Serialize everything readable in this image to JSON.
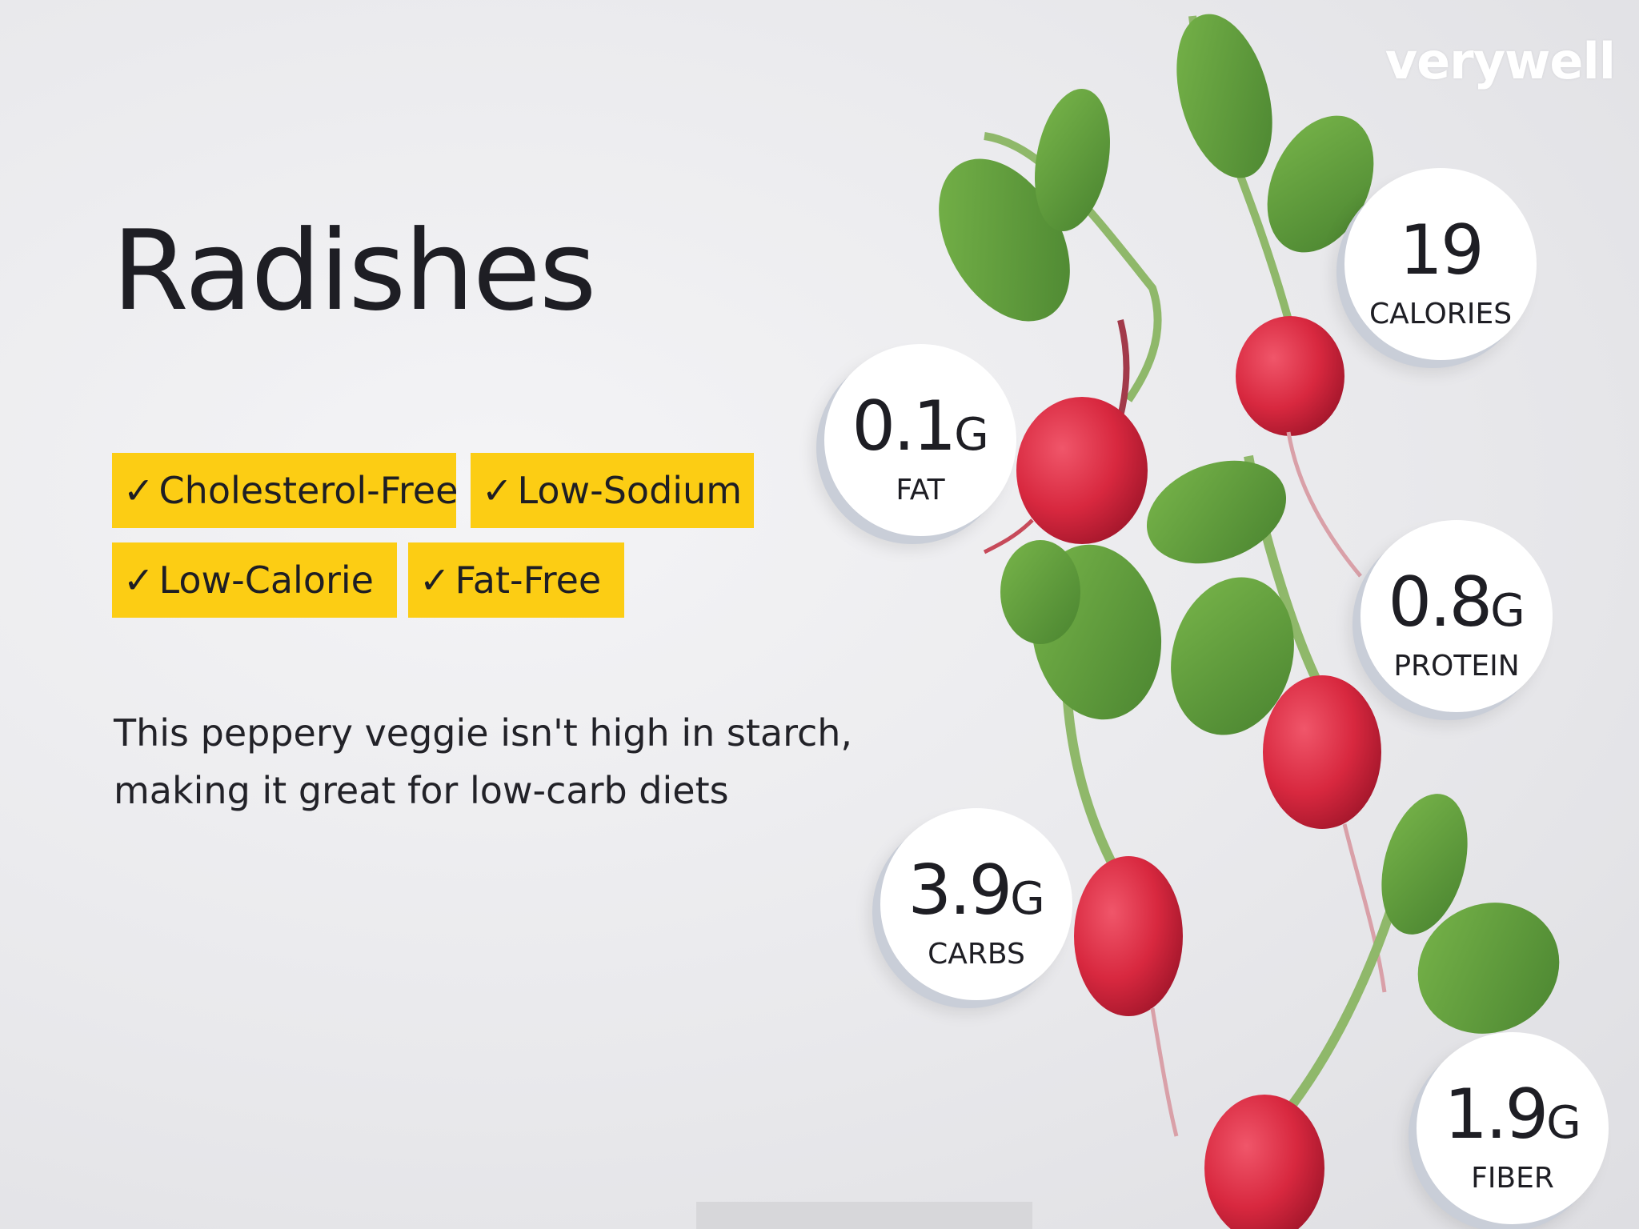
{
  "brand": "verywell",
  "title": "Radishes",
  "badges": [
    {
      "check": "✓",
      "label": "Cholesterol-Free"
    },
    {
      "check": "✓",
      "label": "Low-Sodium"
    },
    {
      "check": "✓",
      "label": "Low-Calorie"
    },
    {
      "check": "✓",
      "label": "Fat-Free"
    }
  ],
  "description_line1": "This peppery veggie isn't high in starch,",
  "description_line2": "making it great for low-carb diets",
  "nutrients": [
    {
      "value": "19",
      "unit": "",
      "label": "CALORIES"
    },
    {
      "value": "0.1",
      "unit": "G",
      "label": "FAT"
    },
    {
      "value": "0.8",
      "unit": "G",
      "label": "PROTEIN"
    },
    {
      "value": "3.9",
      "unit": "G",
      "label": "CARBS"
    },
    {
      "value": "1.9",
      "unit": "G",
      "label": "FIBER"
    }
  ],
  "colors": {
    "badge": "#fccd14",
    "radish": "#d8283f",
    "leaf": "#5f9a3b",
    "text": "#1e1e24"
  }
}
